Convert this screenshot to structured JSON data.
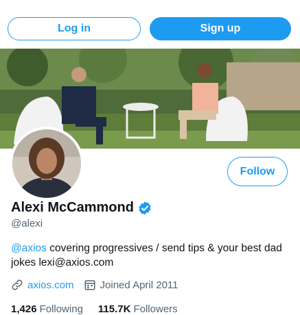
{
  "auth": {
    "login_label": "Log in",
    "signup_label": "Sign up"
  },
  "profile": {
    "name": "Alexi McCammond",
    "handle": "@alexi",
    "follow_label": "Follow",
    "bio_mention": "@axios",
    "bio_text": " covering progressives / send tips & your best dad jokes lexi@axios.com",
    "website": "axios.com",
    "joined": "Joined April 2011",
    "following_count": "1,426",
    "following_label": "Following",
    "followers_count": "115.7K",
    "followers_label": "Followers"
  },
  "icons": {
    "verified": "verified-badge-icon",
    "link": "link-icon",
    "calendar": "calendar-icon"
  },
  "colors": {
    "accent": "#1d9bf0",
    "secondary_text": "#536471",
    "primary_text": "#0f1419"
  }
}
